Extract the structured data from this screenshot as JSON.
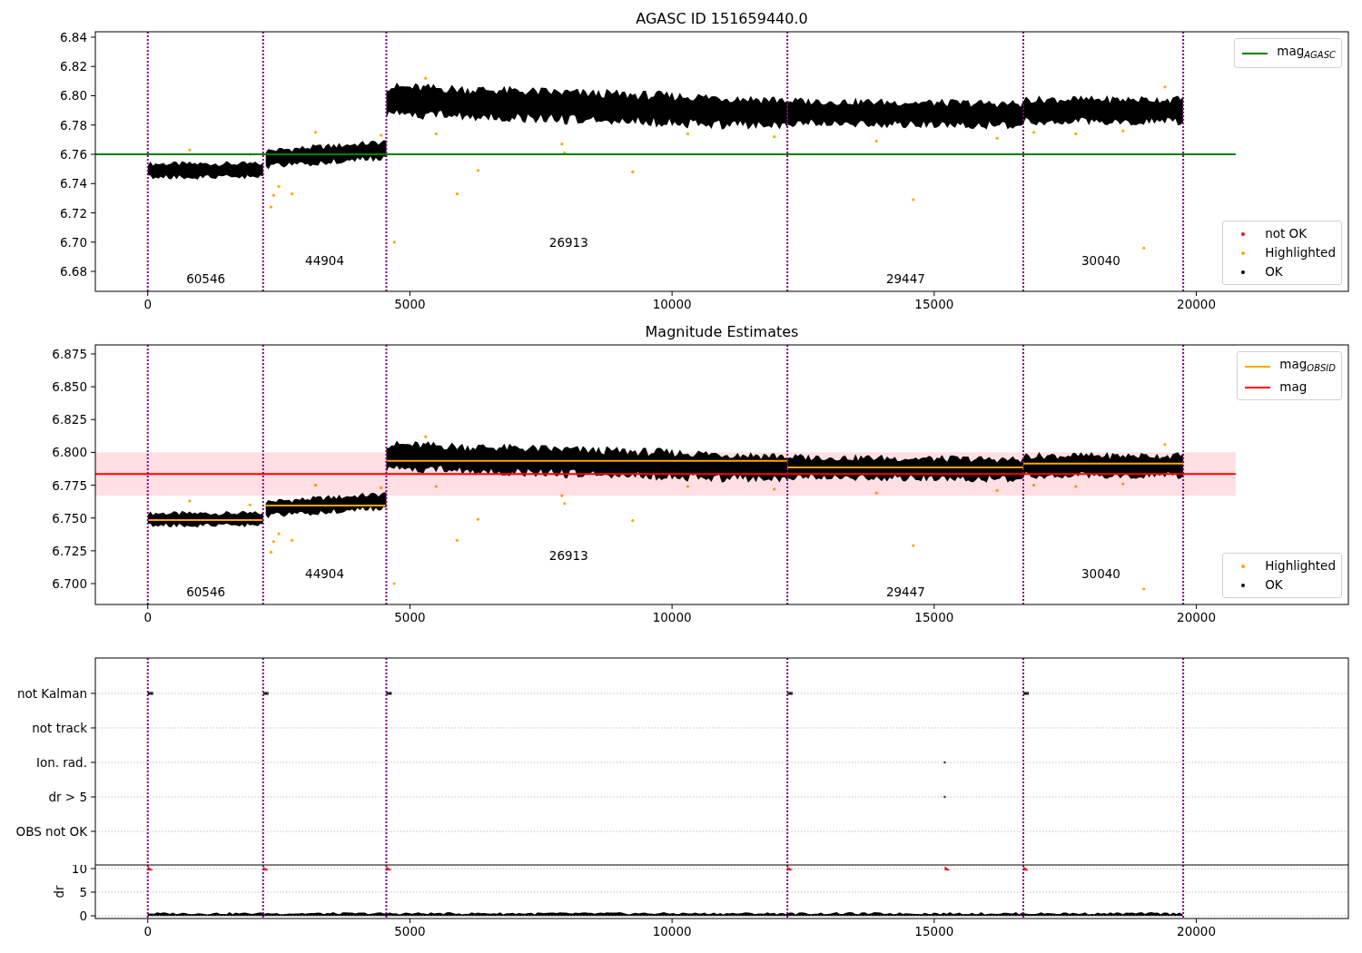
{
  "figure": {
    "panels": [
      {
        "kind": "magnitude",
        "title": "AGASC ID 151659440.0",
        "chart_data": {
          "type": "line",
          "xlim": [
            -1000,
            22900
          ],
          "ylim": [
            6.6664,
            6.8437
          ],
          "xticks": [
            0,
            5000,
            10000,
            15000,
            20000
          ],
          "yticks": [
            {
              "value": 6.68,
              "label": "6.68"
            },
            {
              "value": 6.7,
              "label": "6.70"
            },
            {
              "value": 6.72,
              "label": "6.72"
            },
            {
              "value": 6.74,
              "label": "6.74"
            },
            {
              "value": 6.76,
              "label": "6.76"
            },
            {
              "value": 6.78,
              "label": "6.78"
            },
            {
              "value": 6.8,
              "label": "6.80"
            },
            {
              "value": 6.82,
              "label": "6.82"
            },
            {
              "value": 6.84,
              "label": "6.84"
            }
          ],
          "x": [
            -1000,
            20750
          ],
          "series": [
            {
              "name": "mag$_{AGASC}$",
              "color": "#008000",
              "values": [
                6.76,
                6.76
              ]
            }
          ],
          "ref_lines": [
            {
              "axis": "x",
              "value": 0,
              "color": "#800080"
            },
            {
              "axis": "x",
              "value": 2200,
              "color": "#800080"
            },
            {
              "axis": "x",
              "value": 4550,
              "color": "#800080"
            },
            {
              "axis": "x",
              "value": 12200,
              "color": "#800080"
            },
            {
              "axis": "x",
              "value": 16700,
              "color": "#800080"
            },
            {
              "axis": "x",
              "value": 19750,
              "color": "#800080"
            }
          ],
          "annotations": [
            "60546",
            "44904",
            "26913",
            "29447",
            "30040"
          ]
        },
        "legends": [
          {
            "entries": [
              {
                "kind": "marker",
                "label": "not OK",
                "color": "#ff0000"
              },
              {
                "kind": "marker",
                "label": "Highlighted",
                "color": "#ffa500"
              },
              {
                "kind": "marker",
                "label": "OK",
                "color": "#000000"
              }
            ]
          }
        ]
      },
      {
        "kind": "magnitude",
        "title": "Magnitude Estimates",
        "chart_data": {
          "type": "line",
          "xlim": [
            -1000,
            22900
          ],
          "ylim": [
            6.6841,
            6.8819
          ],
          "xticks": [
            0,
            5000,
            10000,
            15000,
            20000
          ],
          "yticks": [
            {
              "value": 6.7,
              "label": "6.700"
            },
            {
              "value": 6.725,
              "label": "6.725"
            },
            {
              "value": 6.75,
              "label": "6.750"
            },
            {
              "value": 6.775,
              "label": "6.775"
            },
            {
              "value": 6.8,
              "label": "6.800"
            },
            {
              "value": 6.825,
              "label": "6.825"
            },
            {
              "value": 6.85,
              "label": "6.850"
            },
            {
              "value": 6.875,
              "label": "6.875"
            }
          ],
          "x": [
            -1000,
            0,
            2200,
            2200,
            2250,
            4550,
            4550,
            4550,
            12200,
            12200,
            12200,
            16700,
            16700,
            16700,
            19750,
            20750
          ],
          "series": [
            {
              "name": "mag$_{OBSID}$",
              "color": "#ffa500",
              "values": [
                null,
                6.7485,
                6.7485,
                null,
                6.7595,
                6.7595,
                null,
                6.7935,
                6.7935,
                null,
                6.7885,
                6.7885,
                null,
                6.7915,
                6.7915,
                null
              ]
            },
            {
              "name": "mag",
              "color": "#ff0000",
              "values": [
                6.7835,
                6.7835,
                6.7835,
                6.7835,
                6.7835,
                6.7835,
                6.7835,
                6.7835,
                6.7835,
                6.7835,
                6.7835,
                6.7835,
                6.7835,
                6.7835,
                6.7835,
                6.7835
              ]
            }
          ],
          "bands": [
            {
              "axis": "y",
              "from": 6.767,
              "to": 6.8,
              "color": "#ffdfe3"
            }
          ],
          "ref_lines": [
            {
              "axis": "x",
              "value": 0,
              "color": "#800080"
            },
            {
              "axis": "x",
              "value": 2200,
              "color": "#800080"
            },
            {
              "axis": "x",
              "value": 4550,
              "color": "#800080"
            },
            {
              "axis": "x",
              "value": 12200,
              "color": "#800080"
            },
            {
              "axis": "x",
              "value": 16700,
              "color": "#800080"
            },
            {
              "axis": "x",
              "value": 19750,
              "color": "#800080"
            }
          ],
          "annotations": [
            "60546",
            "44904",
            "26913",
            "29447",
            "30040"
          ]
        },
        "legends": [
          {
            "entries": [
              {
                "kind": "marker",
                "label": "Highlighted",
                "color": "#ffa500"
              },
              {
                "kind": "marker",
                "label": "OK",
                "color": "#000000"
              }
            ]
          }
        ]
      },
      {
        "kind": "flags",
        "chart_data": {
          "type": "scatter",
          "orientation": "horizontal",
          "xlim": [
            -1000,
            22900
          ],
          "grid": true,
          "categories": [
            "not Kalman",
            "not track",
            "Ion. rad.",
            "dr > 5",
            "OBS not OK"
          ],
          "ref_lines": [
            {
              "axis": "x",
              "value": 0,
              "color": "#800080"
            },
            {
              "axis": "x",
              "value": 2200,
              "color": "#800080"
            },
            {
              "axis": "x",
              "value": 4550,
              "color": "#800080"
            },
            {
              "axis": "x",
              "value": 12200,
              "color": "#800080"
            },
            {
              "axis": "x",
              "value": 16700,
              "color": "#800080"
            },
            {
              "axis": "x",
              "value": 19750,
              "color": "#800080"
            }
          ]
        }
      },
      {
        "kind": "dr",
        "chart_data": {
          "type": "scatter",
          "ylabel": "dr",
          "xlim": [
            -1000,
            22900
          ],
          "ylim": [
            -0.58,
            10.77
          ],
          "grid": true,
          "xticks": [
            0,
            5000,
            10000,
            15000,
            20000
          ],
          "yticks": [
            0,
            5,
            10
          ],
          "ref_lines": [
            {
              "axis": "x",
              "value": 0,
              "color": "#800080"
            },
            {
              "axis": "x",
              "value": 2200,
              "color": "#800080"
            },
            {
              "axis": "x",
              "value": 4550,
              "color": "#800080"
            },
            {
              "axis": "x",
              "value": 12200,
              "color": "#800080"
            },
            {
              "axis": "x",
              "value": 16700,
              "color": "#800080"
            },
            {
              "axis": "x",
              "value": 19750,
              "color": "#800080"
            }
          ]
        }
      }
    ]
  }
}
